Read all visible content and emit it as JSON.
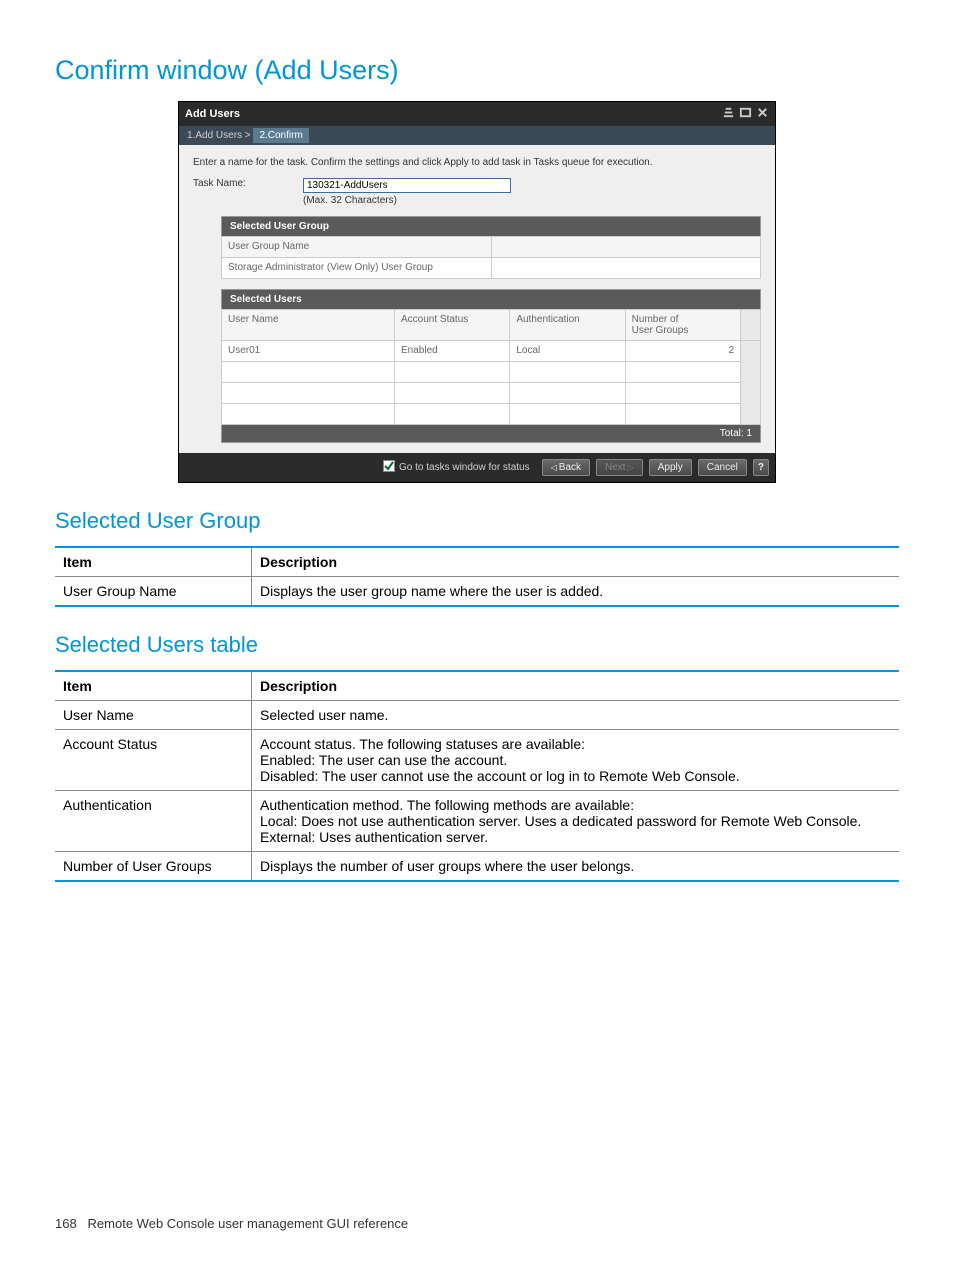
{
  "page_title": "Confirm window (Add Users)",
  "dialog": {
    "title": "Add Users",
    "breadcrumb": {
      "step1": "1.Add Users  >",
      "step2": "2.Confirm"
    },
    "instruction": "Enter a name for the task. Confirm the settings and click Apply to add task in Tasks queue for execution.",
    "task_name_label": "Task Name:",
    "task_name_value": "130321-AddUsers",
    "task_name_hint": "(Max. 32 Characters)",
    "user_group_section": {
      "header": "Selected User Group",
      "col1": "User Group Name",
      "row1": "Storage Administrator (View Only) User Group"
    },
    "users_section": {
      "header": "Selected Users",
      "columns": {
        "c1": "User Name",
        "c2": "Account Status",
        "c3": "Authentication",
        "c4": "Number of\nUser Groups"
      },
      "rows": [
        {
          "username": "User01",
          "status": "Enabled",
          "auth": "Local",
          "groups": "2"
        }
      ],
      "total_label": "Total:  1"
    },
    "footer": {
      "checkbox_label": "Go to tasks window for status",
      "back": "Back",
      "next": "Next",
      "apply": "Apply",
      "cancel": "Cancel",
      "help": "?"
    }
  },
  "section_ug_heading": "Selected User Group",
  "table_ug": {
    "th1": "Item",
    "th2": "Description",
    "r1c1": "User Group Name",
    "r1c2": "Displays the user group name where the user is added."
  },
  "section_users_heading": "Selected Users table",
  "table_users": {
    "th1": "Item",
    "th2": "Description",
    "rows": [
      {
        "item": "User Name",
        "desc": "Selected user name."
      },
      {
        "item": "Account Status",
        "desc": "Account status. The following statuses are available:\nEnabled: The user can use the account.\nDisabled: The user cannot use the account or log in to Remote Web Console."
      },
      {
        "item": "Authentication",
        "desc": "Authentication method. The following methods are available:\nLocal: Does not use authentication server. Uses a dedicated password for Remote Web Console.\nExternal: Uses authentication server."
      },
      {
        "item": "Number of User Groups",
        "desc": "Displays the number of user groups where the user belongs."
      }
    ]
  },
  "footer": {
    "page_num": "168",
    "text": "Remote Web Console user management GUI reference"
  }
}
